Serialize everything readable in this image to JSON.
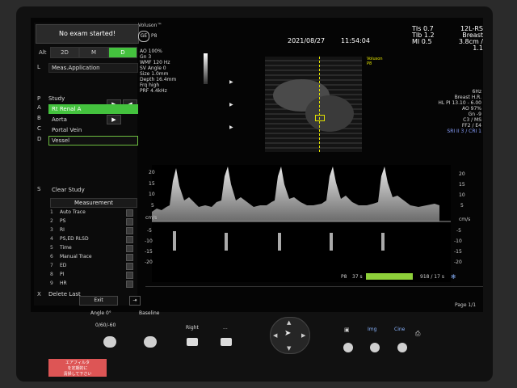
{
  "status": {
    "text": "No exam started!"
  },
  "modes": {
    "alt": "Alt",
    "items": [
      "2D",
      "M",
      "D"
    ],
    "active": "D"
  },
  "meas_application": {
    "key": "L",
    "label": "Meas.Application"
  },
  "study": {
    "key": "P",
    "label": "Study",
    "buttons": [
      "▶",
      "◀",
      "▶"
    ],
    "items": [
      {
        "key": "A",
        "label": "Rt Renal A",
        "state": "active"
      },
      {
        "key": "B",
        "label": "Aorta",
        "state": ""
      },
      {
        "key": "C",
        "label": "Portal Vein",
        "state": ""
      },
      {
        "key": "D",
        "label": "Vessel",
        "state": "outlined"
      }
    ]
  },
  "clear_study": {
    "key": "S",
    "label": "Clear Study"
  },
  "measurement": {
    "header": "Measurement",
    "items": [
      {
        "num": "1",
        "label": "Auto Trace"
      },
      {
        "num": "2",
        "label": "PS"
      },
      {
        "num": "3",
        "label": "RI"
      },
      {
        "num": "4",
        "label": "PS,ED RLSD"
      },
      {
        "num": "5",
        "label": "Time"
      },
      {
        "num": "6",
        "label": "Manual Trace"
      },
      {
        "num": "7",
        "label": "ED"
      },
      {
        "num": "8",
        "label": "PI"
      },
      {
        "num": "9",
        "label": "HR"
      }
    ]
  },
  "delete_last": {
    "key": "X",
    "label": "Delete Last"
  },
  "exit": {
    "label": "Exit"
  },
  "brand": {
    "line1": "Voluson™",
    "line2": "P8"
  },
  "header_info": {
    "date": "2021/08/27",
    "time": "11:54:04"
  },
  "tis": [
    "TIs  0.7",
    "TIb  1.2",
    "MI  0.5"
  ],
  "probe_info": [
    "12L-RS",
    "Breast",
    "3.8cm / 1.1"
  ],
  "doppler_params": [
    "AO 100%",
    "Gn  3",
    "WMF 120 Hz",
    "SV Angle  0",
    "Size  1.0mm",
    "Depth 16.4mm",
    "Frq high",
    "PRF  4.4kHz"
  ],
  "image_params": [
    "6Hz",
    "Breast H.R.",
    "HL PI 13.10 - 6.00",
    "AO 97%",
    "Gn -9",
    "C3 / MS",
    "FF2 / E4",
    "SRI II 3 / CRI 1"
  ],
  "overlay_brand": {
    "line1": "Voluson",
    "line2": "P8"
  },
  "scale": {
    "unit": "cm/s",
    "right_ticks": [
      "20",
      "15",
      "10",
      "5",
      "-5",
      "-10",
      "-15",
      "-20"
    ],
    "left_ticks": [
      "20",
      "15",
      "10",
      "5",
      "-5",
      "-10",
      "-15",
      "-20"
    ]
  },
  "timeline": {
    "left": "P8",
    "left_val": "37 s",
    "right_val": "918 / 17 s"
  },
  "page": {
    "label": "Page 1/1"
  },
  "controls": {
    "angle": "Angle 0°",
    "angle_sub": "0/60/-60",
    "baseline": "Baseline",
    "right": "Right",
    "dots": "...",
    "soft": [
      "Img",
      "Cine"
    ]
  },
  "sticker": {
    "text": "エアフィルタ\nを定期的に\n清掃して下さい"
  }
}
